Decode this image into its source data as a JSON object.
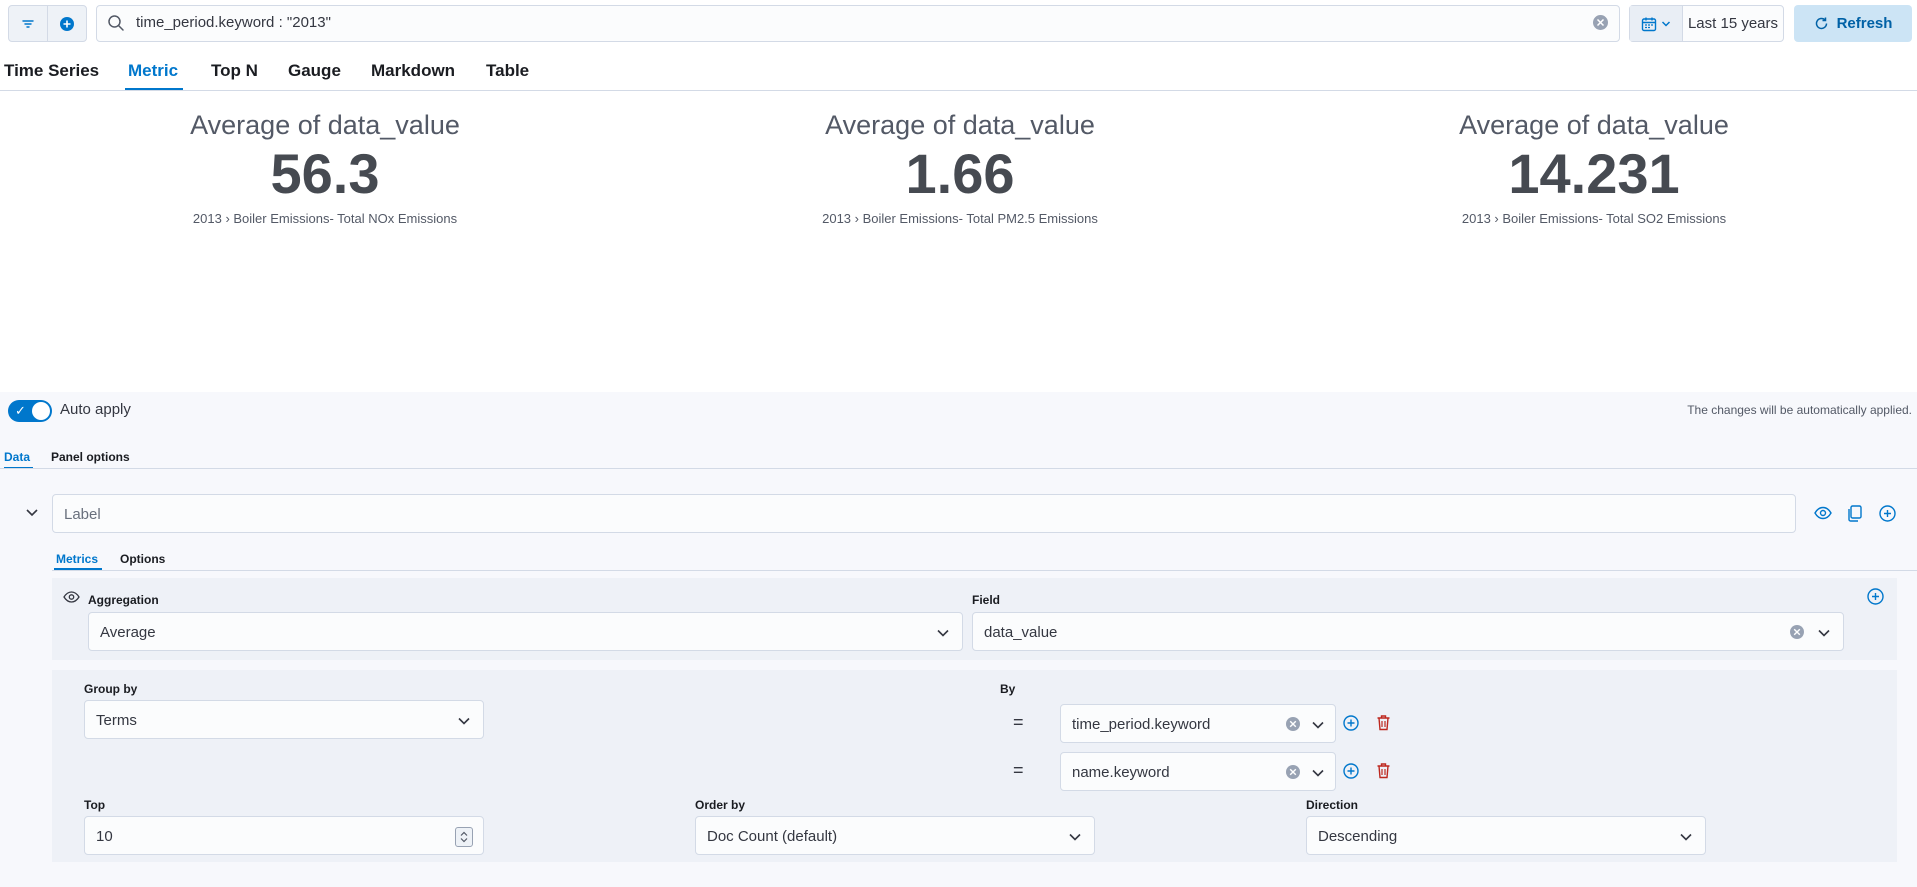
{
  "query": {
    "text": "time_period.keyword : \"2013\""
  },
  "datepicker": {
    "range": "Last 15 years"
  },
  "refresh": {
    "label": "Refresh"
  },
  "viz_tabs": [
    "Time Series",
    "Metric",
    "Top N",
    "Gauge",
    "Markdown",
    "Table"
  ],
  "viz_active_tab": "Metric",
  "metrics": [
    {
      "label": "Average of data_value",
      "value": "56.3",
      "sub": "2013 › Boiler Emissions- Total NOx Emissions"
    },
    {
      "label": "Average of data_value",
      "value": "1.66",
      "sub": "2013 › Boiler Emissions- Total PM2.5 Emissions"
    },
    {
      "label": "Average of data_value",
      "value": "14.231",
      "sub": "2013 › Boiler Emissions- Total SO2 Emissions"
    }
  ],
  "auto_apply": {
    "label": "Auto apply",
    "enabled": true,
    "message": "The changes will be automatically applied."
  },
  "editor_tabs": [
    "Data",
    "Panel options"
  ],
  "series": {
    "label_placeholder": "Label"
  },
  "metric_tabs": [
    "Metrics",
    "Options"
  ],
  "aggregation": {
    "label": "Aggregation",
    "value": "Average"
  },
  "field": {
    "label": "Field",
    "value": "data_value"
  },
  "group_by": {
    "label": "Group by",
    "value": "Terms"
  },
  "by": {
    "label": "By",
    "eq": "=",
    "terms": [
      "time_period.keyword",
      "name.keyword"
    ]
  },
  "top": {
    "label": "Top",
    "value": "10"
  },
  "order_by": {
    "label": "Order by",
    "value": "Doc Count (default)"
  },
  "direction": {
    "label": "Direction",
    "value": "Descending"
  },
  "colors": {
    "accent": "#0077cc",
    "danger": "#bd271e"
  }
}
